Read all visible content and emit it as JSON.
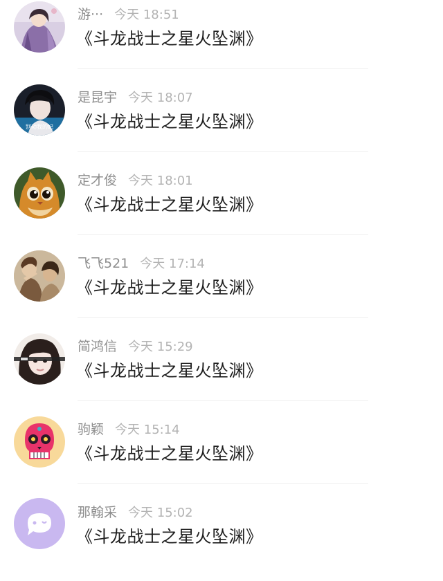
{
  "comments": [
    {
      "name": "游···",
      "time": "今天 18:51",
      "message": "《斗龙战士之星火坠渊》",
      "avatar_icon": "anime-girl-purple-avatar-icon"
    },
    {
      "name": "是昆宇",
      "time": "今天 18:07",
      "message": "《斗龙战士之星火坠渊》",
      "avatar_icon": "boy-portrait-blue-avatar-icon",
      "avatar_caption": "别动我的妃"
    },
    {
      "name": "定才俊",
      "time": "今天 18:01",
      "message": "《斗龙战士之星火坠渊》",
      "avatar_icon": "puss-in-boots-cat-avatar-icon"
    },
    {
      "name": "飞飞521",
      "time": "今天 17:14",
      "message": "《斗龙战士之星火坠渊》",
      "avatar_icon": "two-people-sepia-avatar-icon"
    },
    {
      "name": "简鸿信",
      "time": "今天 15:29",
      "message": "《斗龙战士之星火坠渊》",
      "avatar_icon": "girl-bangs-portrait-avatar-icon"
    },
    {
      "name": "驹颖",
      "time": "今天 15:14",
      "message": "《斗龙战士之星火坠渊》",
      "avatar_icon": "pink-sugar-skull-avatar-icon"
    },
    {
      "name": "那翰采",
      "time": "今天 15:02",
      "message": "《斗龙战士之星火坠渊》",
      "avatar_icon": "purple-chat-bubble-avatar-icon"
    }
  ],
  "colors": {
    "name": "#8e8e8e",
    "time": "#b3b3b3",
    "message": "#1e1e1e",
    "divider": "#eeeeee",
    "default_avatar_purple": "#c9b8f0"
  }
}
